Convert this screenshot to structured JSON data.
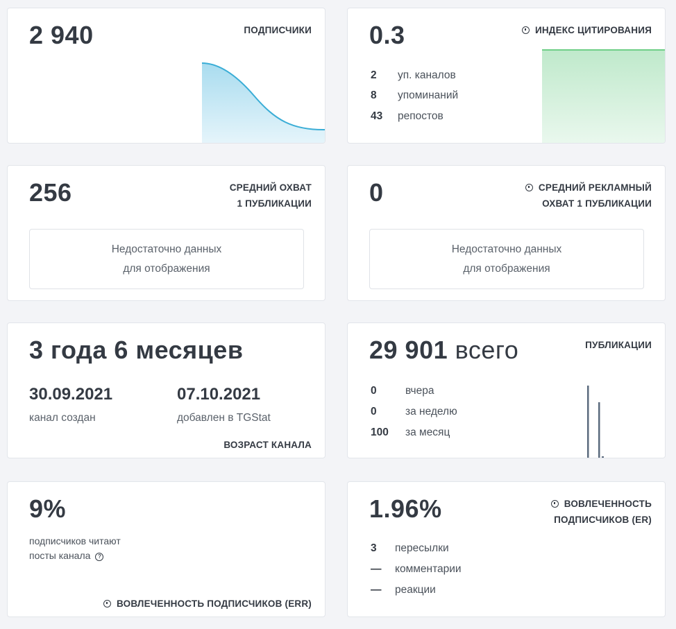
{
  "subscribers": {
    "value": "2 940",
    "label": "ПОДПИСЧИКИ",
    "chart_color": "#3aadd6"
  },
  "citation": {
    "value": "0.3",
    "label": "ИНДЕКС ЦИТИРОВАНИЯ",
    "stats": [
      {
        "num": "2",
        "text": "уп. каналов"
      },
      {
        "num": "8",
        "text": "упоминаний"
      },
      {
        "num": "43",
        "text": "репостов"
      }
    ],
    "chart_color": "#6fcf87"
  },
  "avg_reach": {
    "value": "256",
    "label_line1": "СРЕДНИЙ ОХВАТ",
    "label_line2": "1 ПУБЛИКАЦИИ",
    "nodata_line1": "Недостаточно данных",
    "nodata_line2": "для отображения"
  },
  "ad_reach": {
    "value": "0",
    "label_line1": "СРЕДНИЙ РЕКЛАМНЫЙ",
    "label_line2": "ОХВАТ 1 ПУБЛИКАЦИИ",
    "nodata_line1": "Недостаточно данных",
    "nodata_line2": "для отображения"
  },
  "age": {
    "value": "3 года 6 месяцев",
    "created_date": "30.09.2021",
    "created_label": "канал создан",
    "added_date": "07.10.2021",
    "added_label": "добавлен в TGStat",
    "label": "ВОЗРАСТ КАНАЛА"
  },
  "publications": {
    "value": "29 901",
    "value_suffix": "всего",
    "label": "ПУБЛИКАЦИИ",
    "stats": [
      {
        "num": "0",
        "text": "вчера"
      },
      {
        "num": "0",
        "text": "за неделю"
      },
      {
        "num": "100",
        "text": "за месяц"
      }
    ],
    "bar_color": "#5b6b7e"
  },
  "err": {
    "value": "9%",
    "desc_line1": "подписчиков читают",
    "desc_line2": "посты канала",
    "help_glyph": "?",
    "label": "ВОВЛЕЧЕННОСТЬ ПОДПИСЧИКОВ (ERR)"
  },
  "er": {
    "value": "1.96%",
    "label_line1": "ВОВЛЕЧЕННОСТЬ",
    "label_line2": "ПОДПИСЧИКОВ (ER)",
    "stats": [
      {
        "num": "3",
        "text": "пересылки"
      },
      {
        "num": "—",
        "text": "комментарии"
      },
      {
        "num": "—",
        "text": "реакции"
      }
    ]
  }
}
